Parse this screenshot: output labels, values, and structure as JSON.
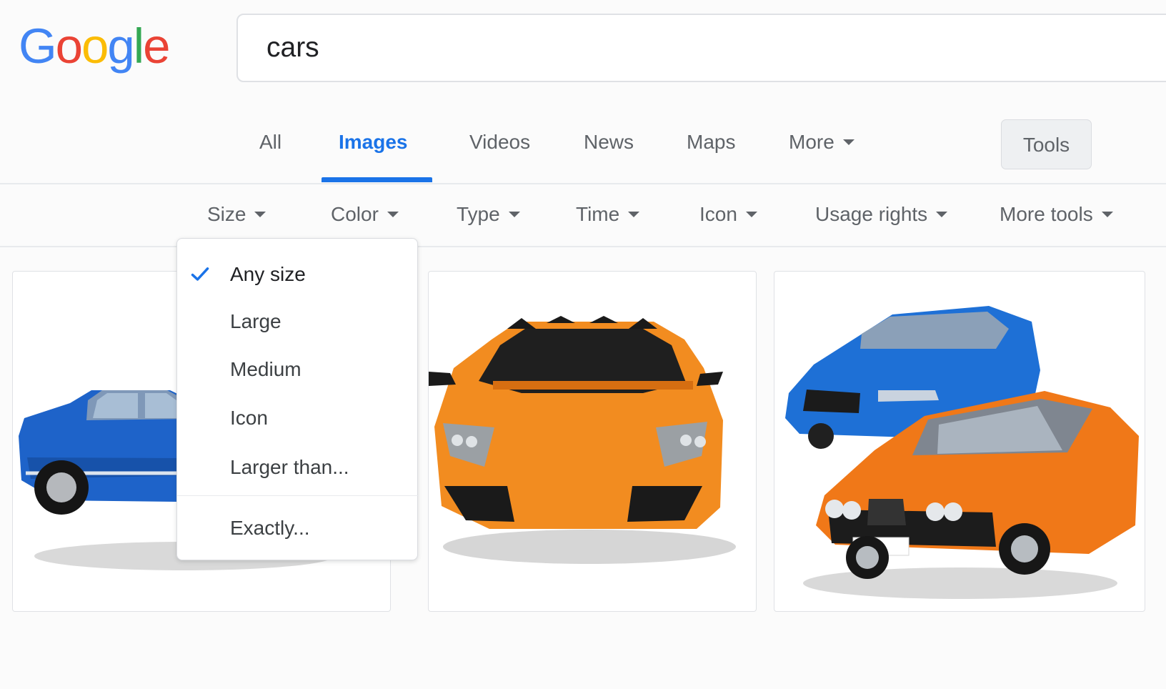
{
  "logo": {
    "letters": [
      "G",
      "o",
      "o",
      "g",
      "l",
      "e"
    ]
  },
  "search": {
    "query": "cars"
  },
  "tabs": [
    {
      "label": "All"
    },
    {
      "label": "Images"
    },
    {
      "label": "Videos"
    },
    {
      "label": "News"
    },
    {
      "label": "Maps"
    },
    {
      "label": "More"
    }
  ],
  "active_tab": "Images",
  "tools_label": "Tools",
  "tool_filters": [
    {
      "label": "Size"
    },
    {
      "label": "Color"
    },
    {
      "label": "Type"
    },
    {
      "label": "Time"
    },
    {
      "label": "Icon"
    },
    {
      "label": "Usage rights"
    },
    {
      "label": "More tools"
    }
  ],
  "size_menu": {
    "items": [
      {
        "label": "Any size",
        "selected": true
      },
      {
        "label": "Large",
        "selected": false
      },
      {
        "label": "Medium",
        "selected": false
      },
      {
        "label": "Icon",
        "selected": false
      },
      {
        "label": "Larger than...",
        "selected": false
      },
      {
        "label": "Exactly...",
        "selected": false
      }
    ]
  },
  "icons": {
    "check": "check-icon",
    "dropdown": "chevron-down-icon"
  },
  "colors": {
    "google_blue": "#4285f4",
    "google_red": "#ea4335",
    "google_yellow": "#fbbc05",
    "google_green": "#34a853",
    "accent": "#1a73e8"
  }
}
